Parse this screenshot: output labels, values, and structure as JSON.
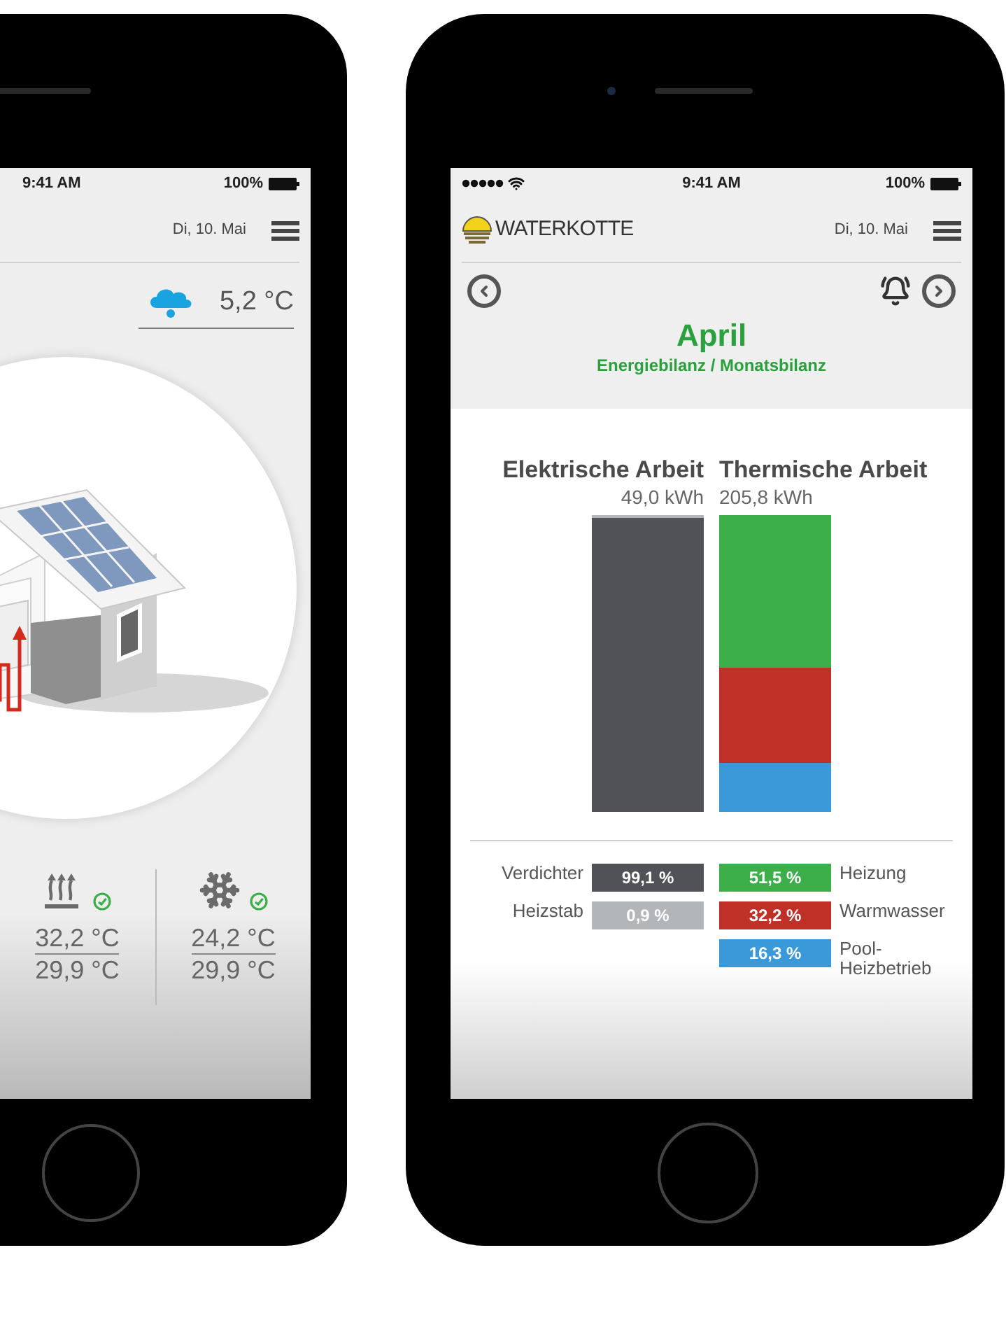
{
  "left_phone": {
    "status_bar": {
      "time": "9:41 AM",
      "battery": "100%"
    },
    "header": {
      "date": "Di, 10. Mai"
    },
    "weather": {
      "temperature": "5,2 °C"
    },
    "circuits": [
      {
        "kind": "heating",
        "ok": true,
        "flow": "32,2 °C",
        "return": "29,9 °C"
      },
      {
        "kind": "cooling",
        "ok": true,
        "flow": "24,2 °C",
        "return": "29,9 °C"
      }
    ]
  },
  "right_phone": {
    "status_bar": {
      "time": "9:41 AM",
      "battery": "100%"
    },
    "header": {
      "brand": "WATERKOTTE",
      "date": "Di, 10. Mai"
    },
    "title": "April",
    "subtitle": "Energiebilanz / Monatsbilanz",
    "balance": {
      "columns": [
        {
          "title": "Elektrische Arbeit",
          "total": "49,0 kWh",
          "items": [
            {
              "label": "Verdichter",
              "value": "99,1 %",
              "color": "#505257"
            },
            {
              "label": "Heizstab",
              "value": "0,9 %",
              "color": "#b3b6b9"
            }
          ]
        },
        {
          "title": "Thermische Arbeit",
          "total": "205,8 kWh",
          "items": [
            {
              "label": "Heizung",
              "value": "51,5 %",
              "color": "#3cae4a"
            },
            {
              "label": "Warmwasser",
              "value": "32,2 %",
              "color": "#bf3127"
            },
            {
              "label": "Pool-Heizbetrieb",
              "value": "16,3 %",
              "color": "#3a9ad9"
            }
          ]
        }
      ]
    }
  }
}
